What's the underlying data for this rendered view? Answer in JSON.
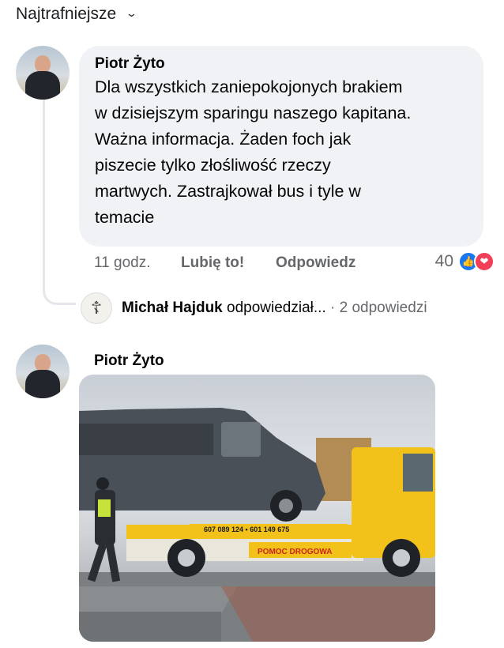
{
  "sort": {
    "label": "Najtrafniejsze"
  },
  "comment1": {
    "author": "Piotr Żyto",
    "text": "Dla wszystkich zaniepokojonych brakiem\nw dzisiejszym sparingu naszego kapitana.\nWażna informacja. Żaden foch jak\npiszecie tylko złośliwość rzeczy\nmartwych. Zastrajkował bus i tyle w\ntemacie",
    "time": "11 godz.",
    "like_label": "Lubię to!",
    "reply_label": "Odpowiedz",
    "reaction_count": "40",
    "reaction_icons": [
      "like-icon",
      "love-icon"
    ]
  },
  "reply_preview": {
    "name": "Michał Hajduk",
    "action": "odpowiedział...",
    "separator": "·",
    "count_label": "2 odpowiedzi"
  },
  "comment2": {
    "author": "Piotr Żyto",
    "photo_texts": {
      "phone_numbers": "607 089 124 • 601 149 675",
      "sign": "POMOC DROGOWA"
    }
  },
  "colors": {
    "bubble_bg": "#f0f2f5",
    "like_blue": "#1877f2",
    "love_red": "#f33e58",
    "tow_yellow": "#f2c21a",
    "van_gray": "#4a5057"
  }
}
